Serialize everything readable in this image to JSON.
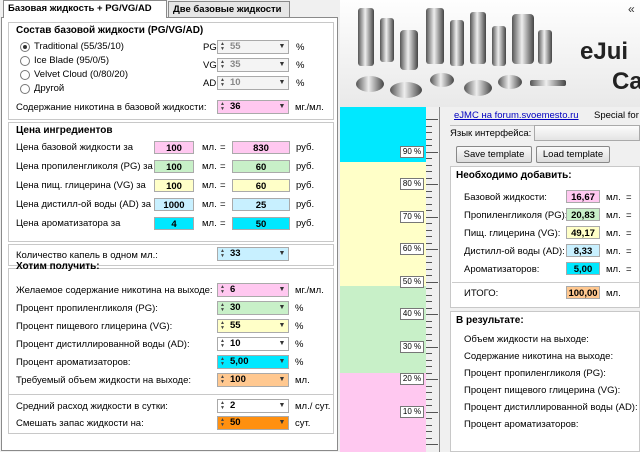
{
  "tabs": [
    "Базовая жидкость + PG/VG/AD",
    "Две базовые жидкости"
  ],
  "base": {
    "title": "Состав базовой жидкости (PG/VG/AD)",
    "options": [
      "Traditional (55/35/10)",
      "Ice Blade (95/0/5)",
      "Velvet Cloud (0/80/20)",
      "Другой"
    ],
    "pg_label": "PG",
    "pg": "55",
    "vg_label": "VG",
    "vg": "35",
    "ad_label": "AD",
    "ad": "10",
    "pct": "%",
    "nic_label": "Содержание никотина в базовой жидкости:",
    "nic": "36",
    "nic_unit": "мг./мл."
  },
  "prices": {
    "title": "Цена ингредиентов",
    "ml": "мл.",
    "eq": "=",
    "rub": "руб.",
    "rows": [
      {
        "label": "Цена базовой жидкости за",
        "qty": "100",
        "price": "830",
        "color": "#ffc8f0"
      },
      {
        "label": "Цена пропиленгликоля (PG) за",
        "qty": "100",
        "price": "60",
        "color": "#c8f0c8"
      },
      {
        "label": "Цена пищ. глицерина (VG) за",
        "qty": "100",
        "price": "60",
        "color": "#ffffc8"
      },
      {
        "label": "Цена дистилл-ой воды (AD) за",
        "qty": "1000",
        "price": "25",
        "color": "#c8f0ff"
      },
      {
        "label": "Цена ароматизатора за",
        "qty": "4",
        "price": "50",
        "color": "#00e8ff"
      }
    ]
  },
  "drops": {
    "label": "Количество капель в одном мл.:",
    "value": "33"
  },
  "want": {
    "title": "Хотим получить:",
    "rows": [
      {
        "label": "Желаемое содержание никотина на выходе:",
        "value": "6",
        "unit": "мг./мл.",
        "color": "#ffc8f0"
      },
      {
        "label": "Процент пропиленгликоля (PG):",
        "value": "30",
        "unit": "%",
        "color": "#c8f0c8"
      },
      {
        "label": "Процент пищевого глицерина (VG):",
        "value": "55",
        "unit": "%",
        "color": "#ffffc8"
      },
      {
        "label": "Процент дистиллированной воды (AD):",
        "value": "10",
        "unit": "%",
        "color": "#ffffff"
      },
      {
        "label": "Процент ароматизаторов:",
        "value": "5,00",
        "unit": "%",
        "color": "#00e8ff"
      },
      {
        "label": "Требуемый объем жидкости на выходе:",
        "value": "100",
        "unit": "мл.",
        "color": "#ffc890"
      }
    ]
  },
  "daily": {
    "label": "Средний расход жидкости в сутки:",
    "value": "2",
    "unit": "мл./ сут."
  },
  "stock": {
    "label": "Смешать запас жидкости на:",
    "value": "50",
    "unit": "сут."
  },
  "banner": {
    "title1": "eJui",
    "title2": "Ca",
    "arrows": "«"
  },
  "forum_link": "eJMC на forum.svoemesto.ru",
  "special": "Special for",
  "lang_label": "Язык интерфейса:",
  "save_btn": "Save template",
  "load_btn": "Load template",
  "need": {
    "title": "Необходимо добавить:",
    "ml": "мл.",
    "eq": "=",
    "rows": [
      {
        "label": "Базовой жидкости:",
        "value": "16,67",
        "color": "#ffc8f0"
      },
      {
        "label": "Пропиленгликоля (PG):",
        "value": "20,83",
        "color": "#c8f0c8"
      },
      {
        "label": "Пищ. глицерина (VG):",
        "value": "49,17",
        "color": "#ffffc8"
      },
      {
        "label": "Дистилл-ой воды (AD):",
        "value": "8,33",
        "color": "#c8f0ff"
      },
      {
        "label": "Ароматизаторов:",
        "value": "5,00",
        "color": "#00e8ff"
      }
    ],
    "total_label": "ИТОГО:",
    "total": "100,00",
    "total_color": "#ffc890"
  },
  "result": {
    "title": "В результате:",
    "rows": [
      "Объем жидкости на выходе:",
      "Содержание никотина на выходе:",
      "Процент пропиленгликоля (PG):",
      "Процент пищевого глицерина (VG):",
      "Процент дистиллированной воды (AD):",
      "Процент ароматизаторов:"
    ]
  },
  "scale": {
    "marks": [
      "90 %",
      "80 %",
      "70 %",
      "60 %",
      "50 %",
      "40 %",
      "30 %",
      "20 %",
      "10 %"
    ]
  }
}
